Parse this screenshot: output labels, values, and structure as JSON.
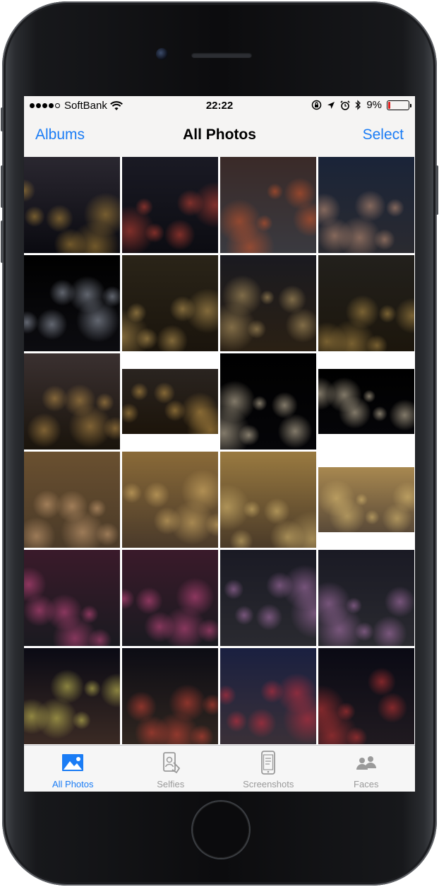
{
  "status_bar": {
    "carrier": "SoftBank",
    "time": "22:22",
    "battery_percent": "9%",
    "battery_level": 0.09,
    "signal_bars_filled": 4,
    "signal_bars_total": 5,
    "icons": [
      "wifi-icon",
      "orientation-lock-icon",
      "location-arrow-icon",
      "alarm-icon",
      "bluetooth-icon",
      "battery-icon"
    ]
  },
  "nav": {
    "back_label": "Albums",
    "title": "All Photos",
    "action_label": "Select"
  },
  "accent_color": "#1a7cf5",
  "photos": [
    {
      "id": "times-square-street-1",
      "top": "#2a2730",
      "bottom": "#0a0a10",
      "accent": "#c89a40"
    },
    {
      "id": "times-square-signs-1",
      "top": "#1a1a24",
      "bottom": "#0c0c12",
      "accent": "#e04a3a"
    },
    {
      "id": "times-square-traffic",
      "top": "#3a2a28",
      "bottom": "#3a3a40",
      "accent": "#e05a2a"
    },
    {
      "id": "selfie-couple-night",
      "top": "#1a2438",
      "bottom": "#2a2a30",
      "accent": "#d8a080"
    },
    {
      "id": "empire-state-building",
      "top": "#000000",
      "bottom": "#0c0c10",
      "accent": "#b0b8c8"
    },
    {
      "id": "manhattan-skyline-1",
      "top": "#2a2418",
      "bottom": "#1a140c",
      "accent": "#d8b060"
    },
    {
      "id": "manhattan-skyline-2",
      "top": "#1a1a20",
      "bottom": "#2a2014",
      "accent": "#d0b070"
    },
    {
      "id": "manhattan-skyline-3",
      "top": "#22201c",
      "bottom": "#1c160c",
      "accent": "#c8a050"
    },
    {
      "id": "manhattan-panorama-1",
      "top": "#3a3030",
      "bottom": "#1a140c",
      "accent": "#d0a050"
    },
    {
      "id": "manhattan-panorama-2",
      "top": "#2a2420",
      "bottom": "#1c140a",
      "accent": "#d8a850",
      "letterbox": true
    },
    {
      "id": "observation-silhouettes-1",
      "top": "#000000",
      "bottom": "#050508",
      "accent": "#f0e0c0"
    },
    {
      "id": "observation-silhouettes-2",
      "top": "#000000",
      "bottom": "#050508",
      "accent": "#f0e0c0",
      "letterbox": true
    },
    {
      "id": "grand-central-selfie",
      "top": "#6a5030",
      "bottom": "#4a3a28",
      "accent": "#e0b080"
    },
    {
      "id": "grand-central-hall-1",
      "top": "#8a6a38",
      "bottom": "#4a3a2a",
      "accent": "#e8c070"
    },
    {
      "id": "grand-central-hall-2",
      "top": "#9a7a40",
      "bottom": "#4a3a28",
      "accent": "#e8c878"
    },
    {
      "id": "grand-central-hall-3",
      "top": "#a88850",
      "bottom": "#5a4a38",
      "accent": "#e8c878",
      "letterbox": true
    },
    {
      "id": "times-square-billboards-1",
      "top": "#3a1a2a",
      "bottom": "#1a1a20",
      "accent": "#e05090"
    },
    {
      "id": "times-square-billboards-2",
      "top": "#3a1a2a",
      "bottom": "#1a1a20",
      "accent": "#e05090"
    },
    {
      "id": "times-square-screen-1",
      "top": "#1a1a24",
      "bottom": "#2a2a30",
      "accent": "#c080c0"
    },
    {
      "id": "times-square-screen-2",
      "top": "#1a1a24",
      "bottom": "#2a2a30",
      "accent": "#c080c0"
    },
    {
      "id": "times-square-night-1",
      "top": "#0a0a14",
      "bottom": "#3a2a24",
      "accent": "#e8e060"
    },
    {
      "id": "times-square-night-2",
      "top": "#0c0c14",
      "bottom": "#302620",
      "accent": "#e84a3a"
    },
    {
      "id": "times-square-ticker",
      "top": "#1a2040",
      "bottom": "#3a3038",
      "accent": "#e03040"
    },
    {
      "id": "times-square-flag",
      "top": "#0a0a14",
      "bottom": "#201a20",
      "accent": "#e03a3a"
    }
  ],
  "tabs": [
    {
      "label": "All Photos",
      "icon": "photo-icon",
      "active": true
    },
    {
      "label": "Selfies",
      "icon": "selfie-icon",
      "active": false
    },
    {
      "label": "Screenshots",
      "icon": "screenshot-icon",
      "active": false
    },
    {
      "label": "Faces",
      "icon": "faces-icon",
      "active": false
    }
  ]
}
